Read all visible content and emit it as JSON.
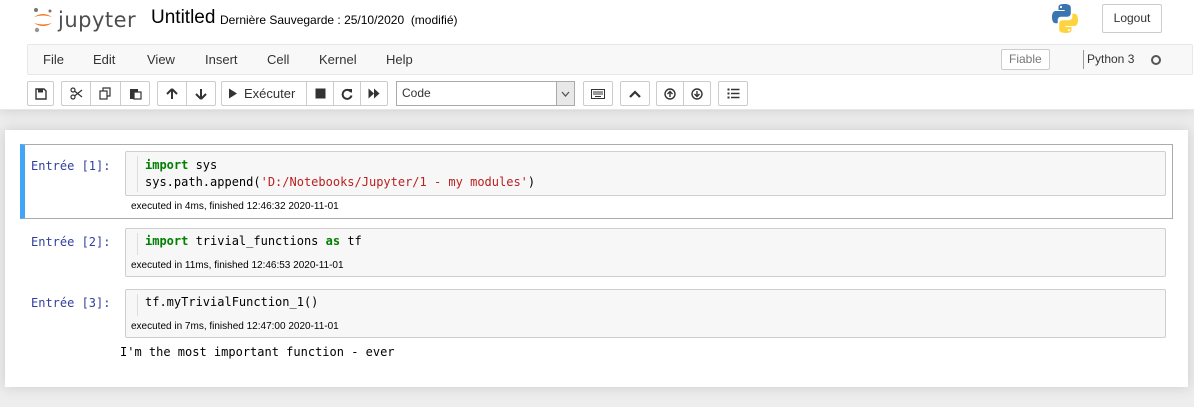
{
  "header": {
    "logo_text": "jupyter",
    "notebook_name": "Untitled",
    "save_info": "Dernière Sauvegarde : 25/10/2020",
    "save_status": "(modifié)",
    "logout_label": "Logout"
  },
  "menubar": {
    "items": [
      "File",
      "Edit",
      "View",
      "Insert",
      "Cell",
      "Kernel",
      "Help"
    ],
    "trusted_label": "Fiable",
    "kernel_name": "Python 3"
  },
  "toolbar": {
    "run_label": "Exécuter",
    "cell_type": "Code"
  },
  "cells": [
    {
      "prompt": "Entrée [1]:",
      "code": [
        [
          {
            "t": "import",
            "k": "kw"
          },
          {
            "t": " sys",
            "k": ""
          }
        ],
        [
          {
            "t": "sys.path.append(",
            "k": ""
          },
          {
            "t": "'D:/Notebooks/Jupyter/1 - my modules'",
            "k": "str"
          },
          {
            "t": ")",
            "k": ""
          }
        ]
      ],
      "exec_info": "executed in 4ms, finished 12:46:32 2020-11-01"
    },
    {
      "prompt": "Entrée [2]:",
      "code": [
        [
          {
            "t": "import",
            "k": "kw"
          },
          {
            "t": " trivial_functions ",
            "k": ""
          },
          {
            "t": "as",
            "k": "kw"
          },
          {
            "t": " tf",
            "k": ""
          }
        ]
      ],
      "exec_info": "executed in 11ms, finished 12:46:53 2020-11-01"
    },
    {
      "prompt": "Entrée [3]:",
      "code": [
        [
          {
            "t": "tf.myTrivialFunction_1()",
            "k": ""
          }
        ]
      ],
      "exec_info": "executed in 7ms, finished 12:47:00 2020-11-01",
      "output": "I'm the most important function - ever"
    }
  ]
}
